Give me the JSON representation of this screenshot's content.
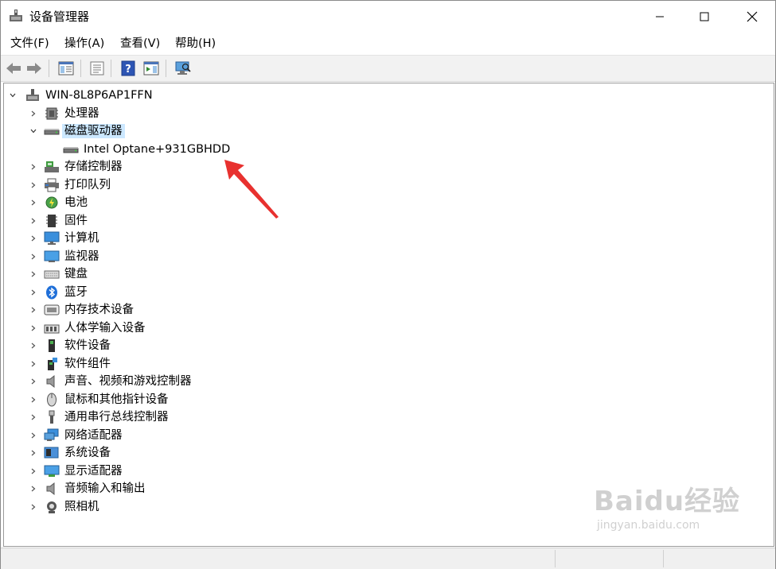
{
  "window": {
    "title": "设备管理器"
  },
  "menubar": {
    "items": [
      {
        "label": "文件(F)"
      },
      {
        "label": "操作(A)"
      },
      {
        "label": "查看(V)"
      },
      {
        "label": "帮助(H)"
      }
    ]
  },
  "toolbar": {
    "buttons": [
      "back-arrow-icon",
      "forward-arrow-icon",
      "show-hide-tree-icon",
      "properties-icon",
      "help-icon",
      "action-pane-icon",
      "scan-hardware-icon"
    ]
  },
  "tree": {
    "root": {
      "label": "WIN-8L8P6AP1FFN",
      "icon": "computer-root-icon",
      "expanded": true
    },
    "categories": [
      {
        "label": "处理器",
        "icon": "processor-icon",
        "expanded": false
      },
      {
        "label": "磁盘驱动器",
        "icon": "disk-drive-icon",
        "expanded": true,
        "selected": true,
        "children": [
          {
            "label": "Intel Optane+931GBHDD",
            "icon": "disk-drive-icon"
          }
        ]
      },
      {
        "label": "存储控制器",
        "icon": "storage-controller-icon",
        "expanded": false
      },
      {
        "label": "打印队列",
        "icon": "printer-icon",
        "expanded": false
      },
      {
        "label": "电池",
        "icon": "battery-icon",
        "expanded": false
      },
      {
        "label": "固件",
        "icon": "firmware-icon",
        "expanded": false
      },
      {
        "label": "计算机",
        "icon": "computer-icon",
        "expanded": false
      },
      {
        "label": "监视器",
        "icon": "monitor-icon",
        "expanded": false
      },
      {
        "label": "键盘",
        "icon": "keyboard-icon",
        "expanded": false
      },
      {
        "label": "蓝牙",
        "icon": "bluetooth-icon",
        "expanded": false
      },
      {
        "label": "内存技术设备",
        "icon": "memory-icon",
        "expanded": false
      },
      {
        "label": "人体学输入设备",
        "icon": "hid-icon",
        "expanded": false
      },
      {
        "label": "软件设备",
        "icon": "software-device-icon",
        "expanded": false
      },
      {
        "label": "软件组件",
        "icon": "software-component-icon",
        "expanded": false
      },
      {
        "label": "声音、视频和游戏控制器",
        "icon": "speaker-icon",
        "expanded": false
      },
      {
        "label": "鼠标和其他指针设备",
        "icon": "mouse-icon",
        "expanded": false
      },
      {
        "label": "通用串行总线控制器",
        "icon": "usb-icon",
        "expanded": false
      },
      {
        "label": "网络适配器",
        "icon": "network-icon",
        "expanded": false
      },
      {
        "label": "系统设备",
        "icon": "system-device-icon",
        "expanded": false
      },
      {
        "label": "显示适配器",
        "icon": "display-adapter-icon",
        "expanded": false
      },
      {
        "label": "音频输入和输出",
        "icon": "audio-io-icon",
        "expanded": false
      },
      {
        "label": "照相机",
        "icon": "camera-icon",
        "expanded": false
      }
    ]
  },
  "annotation": {
    "type": "red-arrow",
    "color": "#e8312f"
  },
  "watermark": {
    "brand": "Baidu经验",
    "url": "jingyan.baidu.com"
  },
  "colors": {
    "selection": "#cce8ff",
    "toolbar_bg": "#f2f2f2",
    "arrow": "#e8312f"
  }
}
